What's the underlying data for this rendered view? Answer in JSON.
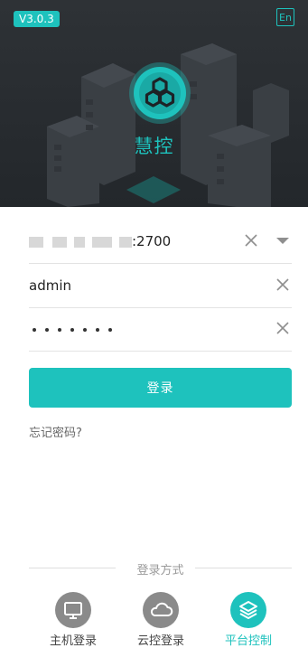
{
  "header": {
    "version": "V3.0.3",
    "lang_toggle": "En",
    "app_name": "慧控"
  },
  "form": {
    "server": {
      "value_suffix": ":2700"
    },
    "username": {
      "value": "admin"
    },
    "password": {
      "masked_length": 7
    },
    "login_label": "登录",
    "forgot_label": "忘记密码?"
  },
  "login_methods": {
    "title": "登录方式",
    "items": [
      {
        "label": "主机登录",
        "icon": "monitor-icon",
        "active": false
      },
      {
        "label": "云控登录",
        "icon": "cloud-icon",
        "active": false
      },
      {
        "label": "平台控制",
        "icon": "layers-icon",
        "active": true
      }
    ]
  },
  "colors": {
    "accent": "#1ec2bd",
    "inactive_icon_bg": "#8a8a8a",
    "hero_bg": "#2b2f33"
  }
}
